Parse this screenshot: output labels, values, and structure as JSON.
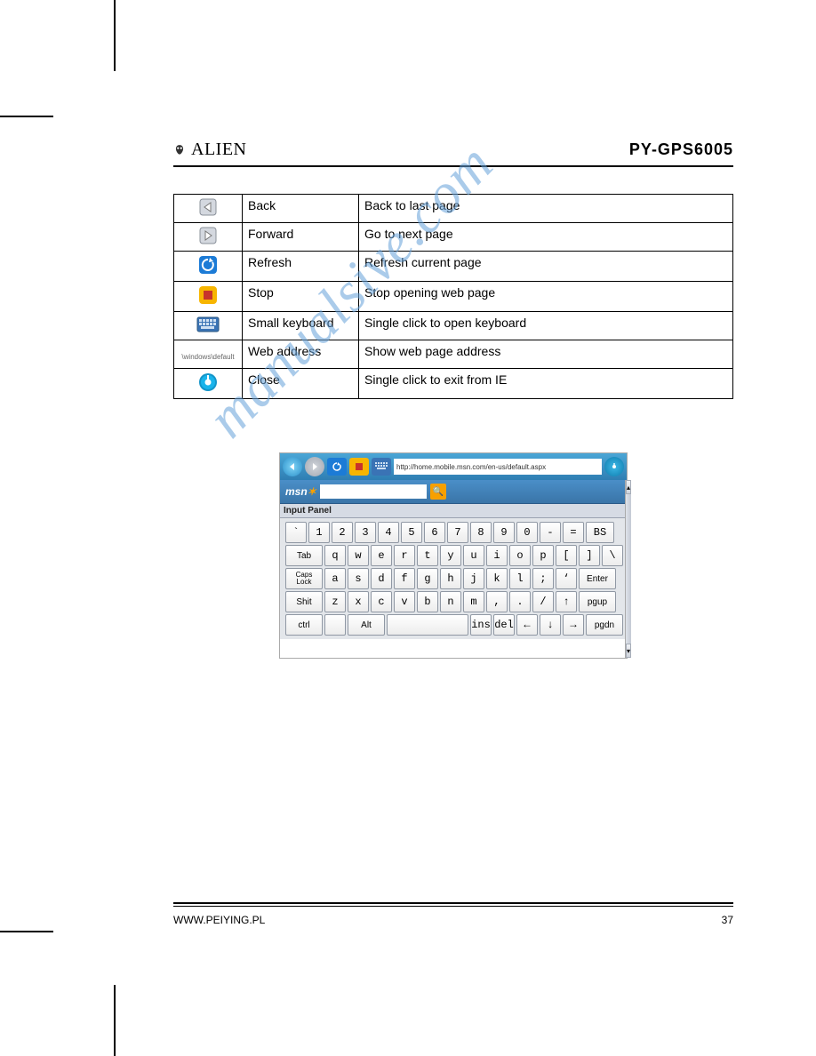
{
  "header": {
    "brand": "ALIEN",
    "model": "PY-GPS6005"
  },
  "table_rows": [
    {
      "icon": "back-icon",
      "name": "Back",
      "desc": "Back to last page"
    },
    {
      "icon": "forward-icon",
      "name": "Forward",
      "desc": "Go to next page"
    },
    {
      "icon": "refresh-icon",
      "name": "Refresh",
      "desc": "Refresh current page"
    },
    {
      "icon": "stop-icon",
      "name": "Stop",
      "desc": "Stop opening web page"
    },
    {
      "icon": "keyboard-icon",
      "name": "Small keyboard",
      "desc": "Single click to open keyboard"
    },
    {
      "icon": "address-text",
      "name": "Web address",
      "desc": "Show web page address"
    },
    {
      "icon": "close-icon",
      "name": "Close",
      "desc": "Single click to exit from IE"
    }
  ],
  "address_icon_text": "\\windows\\default",
  "screenshot": {
    "url": "http://home.mobile.msn.com/en-us/default.aspx",
    "msn_label": "msn",
    "input_panel_label": "Input Panel",
    "kbd": {
      "r1": [
        "`",
        "1",
        "2",
        "3",
        "4",
        "5",
        "6",
        "7",
        "8",
        "9",
        "0",
        "-",
        "=",
        "BS"
      ],
      "r2": [
        "Tab",
        "q",
        "w",
        "e",
        "r",
        "t",
        "y",
        "u",
        "i",
        "o",
        "p",
        "[",
        "]",
        "\\"
      ],
      "r3": [
        "Caps\nLock",
        "a",
        "s",
        "d",
        "f",
        "g",
        "h",
        "j",
        "k",
        "l",
        ";",
        "‘",
        "Enter"
      ],
      "r4": [
        "Shit",
        "z",
        "x",
        "c",
        "v",
        "b",
        "n",
        "m",
        ",",
        ".",
        "/",
        "↑",
        "pgup"
      ],
      "r5": [
        "ctrl",
        "",
        "Alt",
        "",
        "ins",
        "del",
        "←",
        "↓",
        "→",
        "pgdn"
      ]
    }
  },
  "footer": {
    "site": "WWW.PEIYING.PL",
    "page": "37"
  },
  "watermark": "manualsive.com"
}
